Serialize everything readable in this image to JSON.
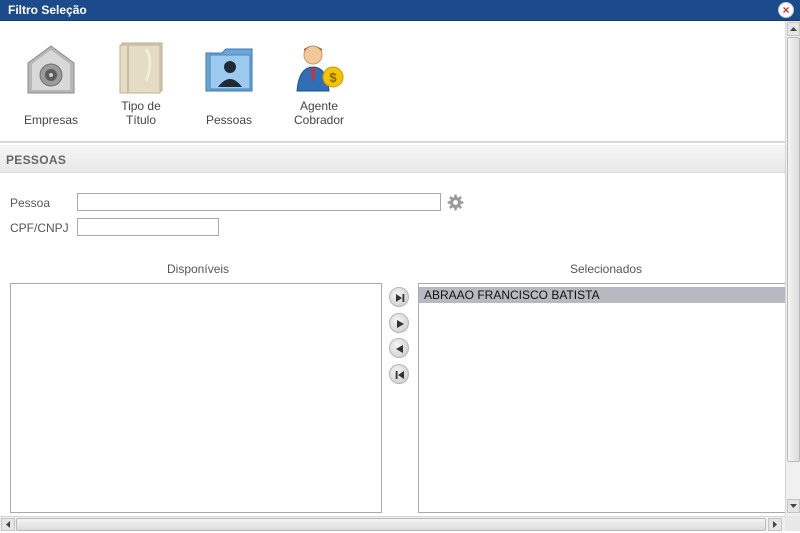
{
  "window": {
    "title": "Filtro Seleção",
    "close_symbol": "×"
  },
  "toolbar": {
    "items": [
      {
        "label_line1": "Empresas",
        "label_line2": "",
        "icon": "building-safe-icon"
      },
      {
        "label_line1": "Tipo de",
        "label_line2": "Título",
        "icon": "document-icon"
      },
      {
        "label_line1": "Pessoas",
        "label_line2": "",
        "icon": "person-folder-icon"
      },
      {
        "label_line1": "Agente",
        "label_line2": "Cobrador",
        "icon": "agent-money-icon"
      }
    ]
  },
  "section": {
    "title": "PESSOAS"
  },
  "form": {
    "pessoa_label": "Pessoa",
    "pessoa_value": "",
    "cpf_label": "CPF/CNPJ",
    "cpf_value": ""
  },
  "lists": {
    "available_title": "Disponíveis",
    "available_items": [],
    "selected_title": "Selecionados",
    "selected_items": [
      "ABRAAO FRANCISCO BATISTA"
    ]
  },
  "colors": {
    "titlebar": "#1c4b8c",
    "selected_row": "#b8b8c0"
  }
}
